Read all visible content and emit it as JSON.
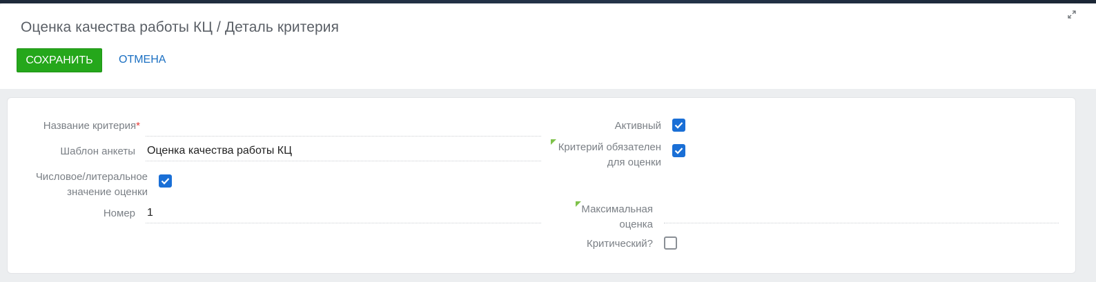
{
  "header": {
    "title": "Оценка качества работы КЦ / Деталь критерия",
    "save_label": "СОХРАНИТЬ",
    "cancel_label": "ОТМЕНА"
  },
  "form": {
    "criterion_name": {
      "label": "Название критерия",
      "required_mark": "*",
      "value": ""
    },
    "template": {
      "label": "Шаблон анкеты",
      "value": "Оценка качества работы КЦ"
    },
    "numeric_literal": {
      "label_line1": "Числовое/литеральное",
      "label_line2": "значение оценки",
      "checked": true
    },
    "number": {
      "label": "Номер",
      "value": "1"
    },
    "active": {
      "label": "Активный",
      "checked": true
    },
    "mandatory": {
      "label_line1": "Критерий обязателен",
      "label_line2": "для оценки",
      "checked": true
    },
    "max_score": {
      "label_line1": "Максимальная",
      "label_line2": "оценка",
      "value": ""
    },
    "critical": {
      "label": "Критический?",
      "checked": false
    }
  },
  "colors": {
    "save_button": "#25a71b",
    "cancel_link": "#1a6fc2",
    "checkbox_checked": "#1a6fd6",
    "hint_marker": "#7ec24a"
  }
}
